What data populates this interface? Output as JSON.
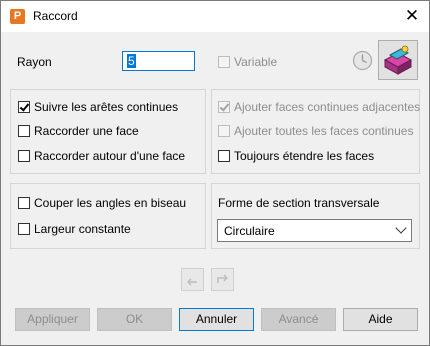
{
  "window": {
    "title": "Raccord",
    "app_icon_letter": "P"
  },
  "rayon": {
    "label": "Rayon",
    "value": "5"
  },
  "variable": {
    "label": "Variable",
    "checked": false,
    "enabled": false
  },
  "left_options": [
    {
      "label": "Suivre les arêtes continues",
      "checked": true
    },
    {
      "label": "Raccorder une face",
      "checked": false
    },
    {
      "label": "Raccorder autour d'une face",
      "checked": false
    }
  ],
  "right_options": [
    {
      "label": "Ajouter faces continues adjacentes",
      "checked": true,
      "enabled": false
    },
    {
      "label": "Ajouter toutes les faces continues",
      "checked": false,
      "enabled": false
    },
    {
      "label": "Toujours étendre les faces",
      "checked": false,
      "enabled": true
    }
  ],
  "bottom_left_options": [
    {
      "label": "Couper les angles en biseau",
      "checked": false
    },
    {
      "label": "Largeur constante",
      "checked": false
    }
  ],
  "section": {
    "label": "Forme de section transversale",
    "selected": "Circulaire"
  },
  "buttons": {
    "appliquer": "Appliquer",
    "ok": "OK",
    "annuler": "Annuler",
    "avance": "Avancé",
    "aide": "Aide"
  },
  "icons": {
    "close": "close-icon",
    "clock": "clock-icon",
    "fillet_tool": "fillet-tool-icon",
    "undo": "undo-arrow-icon",
    "redo": "redo-arrow-icon"
  },
  "colors": {
    "accent": "#0078d7",
    "app_icon": "#e87722",
    "tool_icon": "#d946a8"
  }
}
